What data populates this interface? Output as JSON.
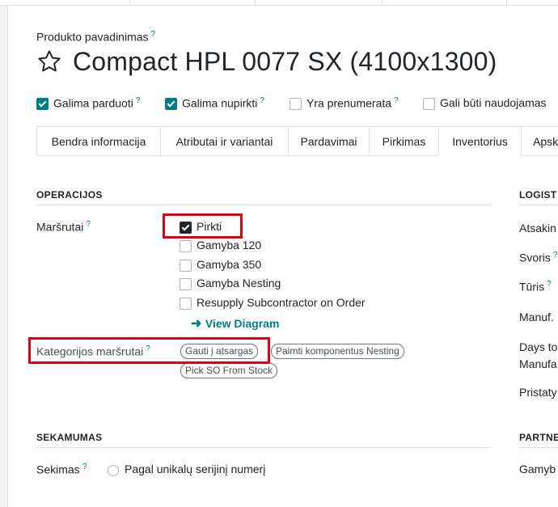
{
  "product": {
    "name_label": "Produkto pavadinimas",
    "help": "?",
    "title": "Compact HPL 0077 SX (4100x1300)",
    "favorite_icon": "star-outline-icon"
  },
  "flags": [
    {
      "label": "Galima parduoti",
      "checked": true
    },
    {
      "label": "Galima nupirkti",
      "checked": true
    },
    {
      "label": "Yra prenumerata",
      "checked": false
    },
    {
      "label": "Gali būti naudojamas",
      "checked": false
    }
  ],
  "tabs": [
    {
      "label": "Bendra informacija"
    },
    {
      "label": "Atributai ir variantai"
    },
    {
      "label": "Pardavimai"
    },
    {
      "label": "Pirkimas"
    },
    {
      "label": "Inventorius",
      "active": true
    },
    {
      "label": "Apsk"
    }
  ],
  "operations": {
    "heading": "OPERACIJOS",
    "routes_label": "Maršrutai",
    "routes": [
      {
        "label": "Pirkti",
        "checked": true
      },
      {
        "label": "Gamyba 120",
        "checked": false
      },
      {
        "label": "Gamyba 350",
        "checked": false
      },
      {
        "label": "Gamyba Nesting",
        "checked": false
      },
      {
        "label": "Resupply Subcontractor on Order",
        "checked": false
      }
    ],
    "view_diagram": "View Diagram",
    "category_routes_label": "Kategorijos maršrutai",
    "category_routes": [
      "Gauti į atsargas",
      "Paimti komponentus Nesting",
      "Pick SO From Stock"
    ]
  },
  "tracking": {
    "heading": "SEKAMUMAS",
    "label": "Sekimas",
    "option": "Pagal unikalų serijinį numerį"
  },
  "logistics": {
    "heading": "LOGIST",
    "fields": [
      "Atsakin",
      "Svoris",
      "Tūris",
      "Manuf.",
      "Days to",
      "Manufa",
      "Pristaty"
    ]
  },
  "partner": {
    "heading": "PARTNE",
    "field": "Gamyb"
  },
  "colors": {
    "accent": "#017e84",
    "highlight": "#e3000f"
  }
}
